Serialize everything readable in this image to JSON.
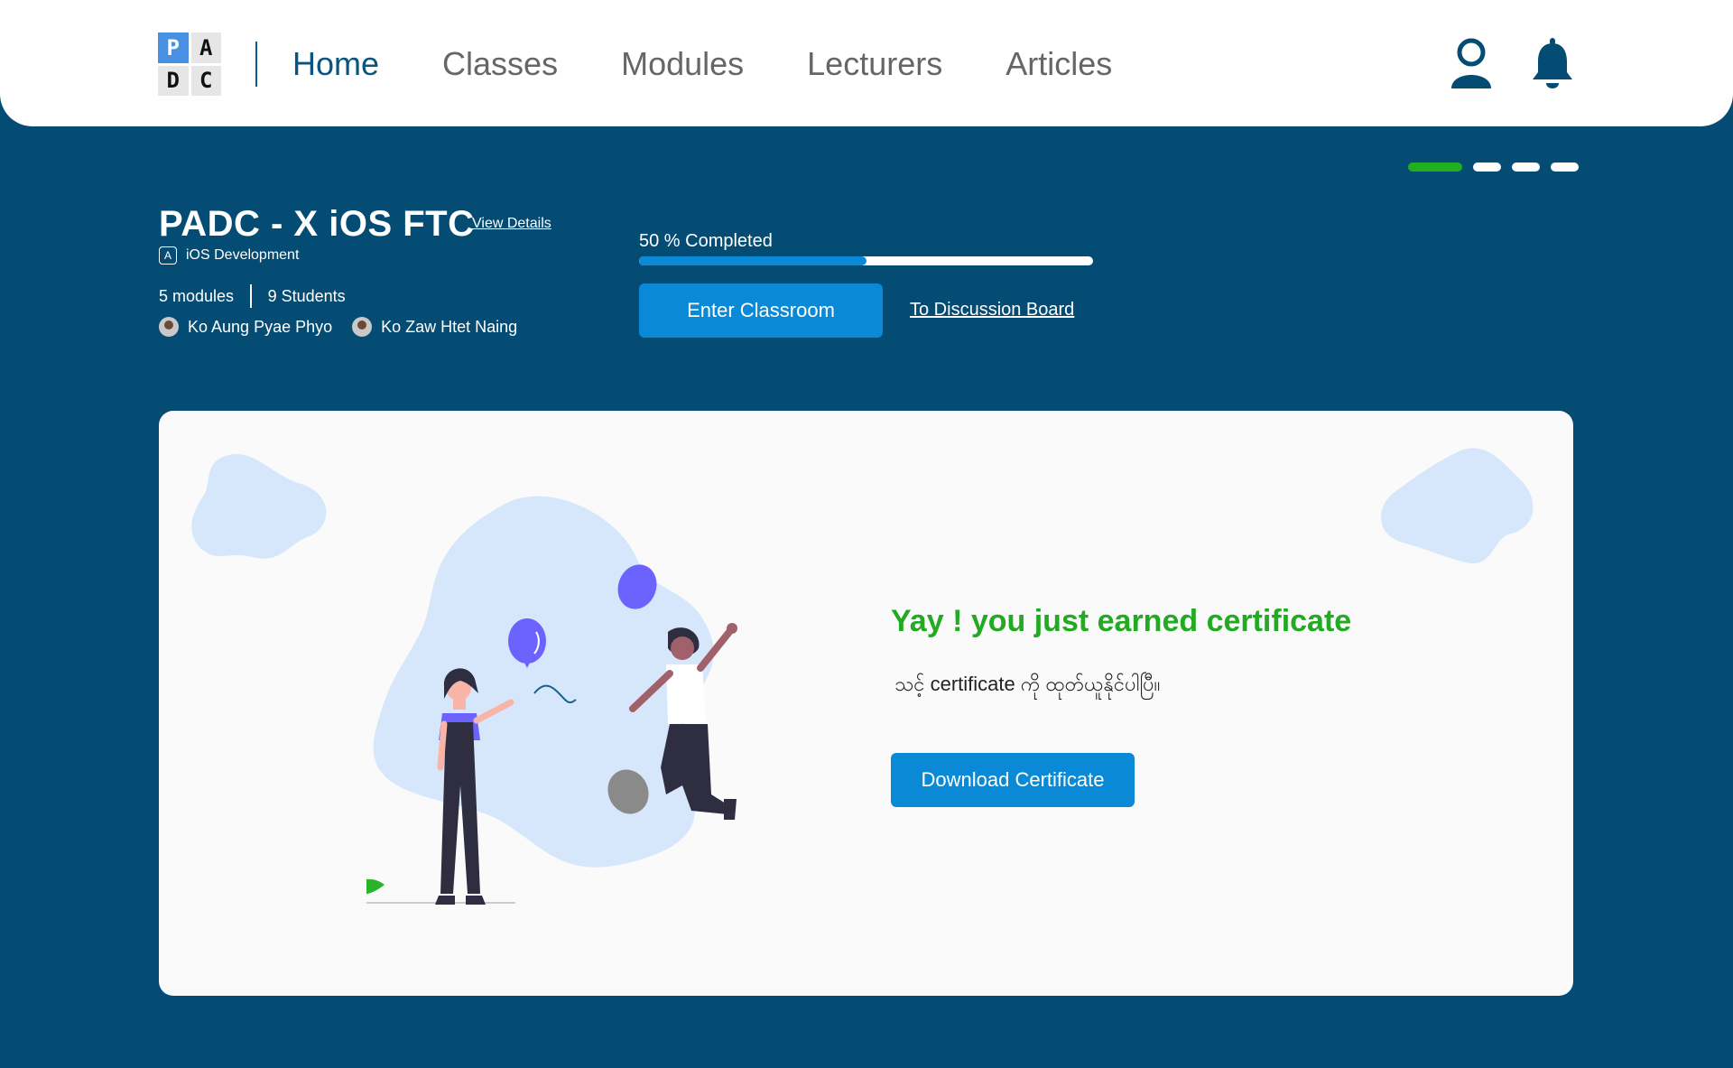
{
  "logo": {
    "letters": [
      "P",
      "A",
      "D",
      "C"
    ]
  },
  "nav": {
    "items": [
      {
        "label": "Home",
        "active": true
      },
      {
        "label": "Classes",
        "active": false
      },
      {
        "label": "Modules",
        "active": false
      },
      {
        "label": "Lecturers",
        "active": false
      },
      {
        "label": "Articles",
        "active": false
      }
    ],
    "icons": [
      "user-icon",
      "bell-icon"
    ]
  },
  "carousel": {
    "count": 4,
    "active_index": 0,
    "active_color": "#20b020"
  },
  "class_info": {
    "title": "PADC - X iOS FTC",
    "view_details": "View Details",
    "category": "iOS Development",
    "category_icon": "app-store-icon",
    "modules": "5 modules",
    "students": "9 Students",
    "lecturers": [
      "Ko Aung Pyae Phyo",
      "Ko Zaw Htet Naing"
    ]
  },
  "progress": {
    "label": "50 % Completed",
    "percent": 50
  },
  "actions": {
    "enter_classroom": "Enter Classroom",
    "discussion_board": "To Discussion Board"
  },
  "certificate": {
    "title": "Yay ! you just earned certificate",
    "subtitle": "သင့် certificate ကို ထုတ်ယူနိုင်ပါပြီ။",
    "download_label": "Download Certificate"
  },
  "colors": {
    "background": "#044c74",
    "accent_blue": "#0a8ad6",
    "success_green": "#22aa22",
    "card": "#fafafa"
  }
}
